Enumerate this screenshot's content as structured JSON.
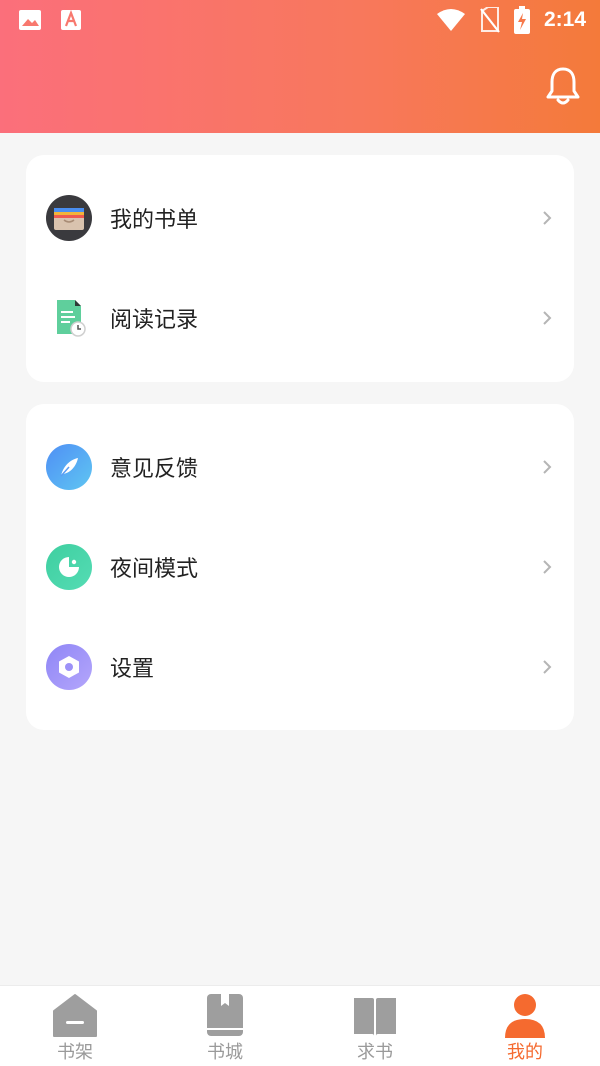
{
  "status_bar": {
    "time": "2:14",
    "icons": [
      "gallery-icon",
      "text-a-icon",
      "wifi-icon",
      "no-sim-icon",
      "battery-charging-icon"
    ]
  },
  "header": {
    "notification_icon": "bell-icon"
  },
  "colors": {
    "header_gradient_start": "#fb6f7b",
    "header_gradient_end": "#f47a3a",
    "accent": "#f56a2f",
    "tab_inactive": "#9a9a9a"
  },
  "menu_group_1": {
    "items": [
      {
        "label": "我的书单",
        "icon": "wallet-icon"
      },
      {
        "label": "阅读记录",
        "icon": "reading-record-icon"
      }
    ]
  },
  "menu_group_2": {
    "items": [
      {
        "label": "意见反馈",
        "icon": "feather-icon"
      },
      {
        "label": "夜间模式",
        "icon": "night-mode-icon"
      },
      {
        "label": "设置",
        "icon": "hex-settings-icon"
      }
    ]
  },
  "tabbar": {
    "tabs": [
      {
        "label": "书架",
        "icon": "home-shelf-icon",
        "active": false
      },
      {
        "label": "书城",
        "icon": "book-icon",
        "active": false
      },
      {
        "label": "求书",
        "icon": "open-book-icon",
        "active": false
      },
      {
        "label": "我的",
        "icon": "person-icon",
        "active": true
      }
    ]
  }
}
